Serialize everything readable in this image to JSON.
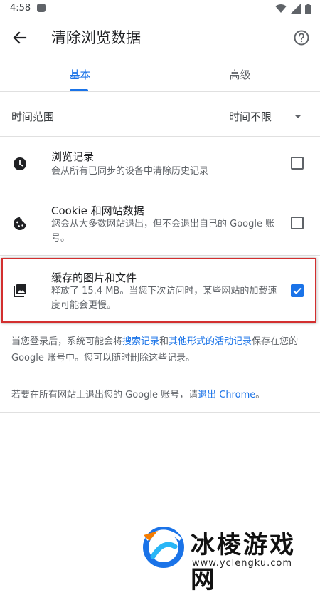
{
  "status_bar": {
    "time": "4:58"
  },
  "app_bar": {
    "title": "清除浏览数据"
  },
  "tabs": [
    {
      "label": "基本",
      "selected": true
    },
    {
      "label": "高级",
      "selected": false
    }
  ],
  "time_range": {
    "label": "时间范围",
    "value": "时间不限"
  },
  "items": [
    {
      "title": "浏览记录",
      "desc": "会从所有已同步的设备中清除历史记录",
      "checked": false,
      "icon": "clock-icon"
    },
    {
      "title": "Cookie 和网站数据",
      "desc": "您会从大多数网站退出，但不会退出自己的 Google 账号。",
      "checked": false,
      "icon": "cookie-icon"
    },
    {
      "title": "缓存的图片和文件",
      "desc": "释放了 15.4 MB。当您下次访问时，某些网站的加载速度可能会更慢。",
      "checked": true,
      "icon": "image-icon"
    }
  ],
  "footer": {
    "p1_a": "当您登录后，系统可能会将",
    "p1_link1": "搜索记录",
    "p1_b": "和",
    "p1_link2": "其他形式的活动记录",
    "p1_c": "保存在您的 Google 账号中。您可以随时删除这些记录。",
    "p2_a": "若要在所有网站上退出您的 Google 账号，请",
    "p2_link": "退出 Chrome",
    "p2_b": "。"
  },
  "watermark": {
    "name": "冰棱游戏网",
    "url": "www.yclengku.com"
  },
  "colors": {
    "accent": "#1a73e8",
    "highlight": "#d32f2f"
  }
}
